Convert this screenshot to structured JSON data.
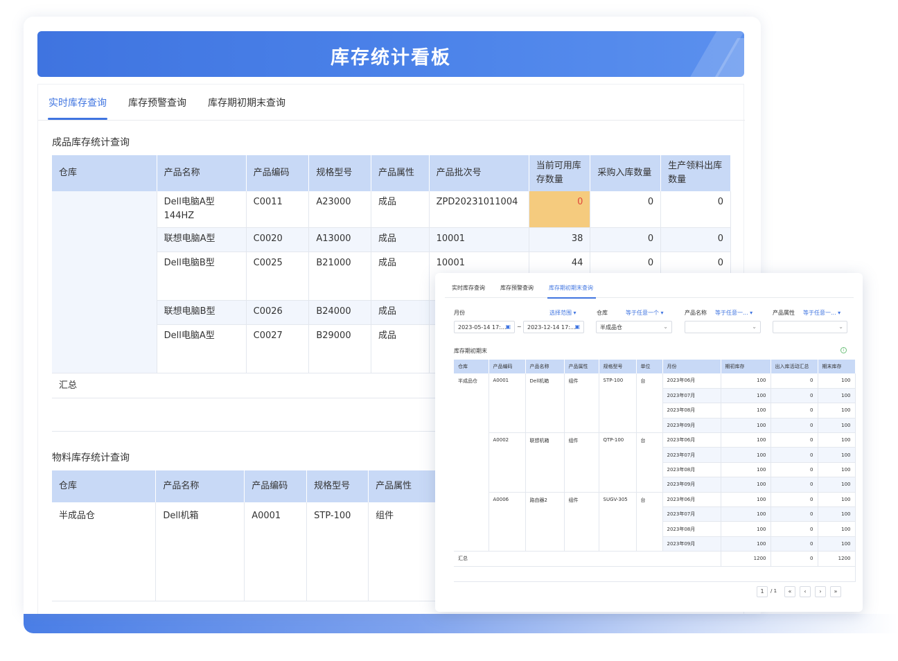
{
  "title": "库存统计看板",
  "tabs": [
    "实时库存查询",
    "库存预警查询",
    "库存期初期末查询"
  ],
  "colors": {
    "accent": "#3f74e0",
    "header_bg": "#c8d9f6",
    "warn_bg": "#f5cb7e",
    "warn_text": "#e0483a"
  },
  "finished": {
    "title": "成品库存统计查询",
    "headers": [
      "仓库",
      "产品名称",
      "产品编码",
      "规格型号",
      "产品属性",
      "产品批次号",
      "当前可用库\n存数量",
      "采购入库数量",
      "生产领料出库\n数量"
    ],
    "rows": [
      [
        "",
        "Dell电脑A型\n144HZ",
        "C0011",
        "A23000",
        "成品",
        "ZPD20231011004",
        "0",
        "0",
        "0"
      ],
      [
        "",
        "联想电脑A型",
        "C0020",
        "A13000",
        "成品",
        "10001",
        "38",
        "0",
        "0"
      ],
      [
        "",
        "Dell电脑B型",
        "C0025",
        "B21000",
        "成品",
        "10001",
        "44",
        "0",
        "0"
      ],
      [
        "",
        "联想电脑B型",
        "C0026",
        "B24000",
        "成品",
        "",
        "",
        "",
        ""
      ],
      [
        "",
        "Dell电脑A型",
        "C0027",
        "B29000",
        "成品",
        "",
        "",
        "",
        ""
      ]
    ],
    "total_label": "汇总"
  },
  "material": {
    "title": "物料库存统计查询",
    "headers": [
      "仓库",
      "产品名称",
      "产品编码",
      "规格型号",
      "产品属性"
    ],
    "rows": [
      [
        "半成品仓",
        "Dell机箱",
        "A0001",
        "STP-100",
        "组件"
      ]
    ]
  },
  "overlay": {
    "tabs": [
      "实时库存查询",
      "库存预警查询",
      "库存期初期末查询"
    ],
    "filters": {
      "month_label": "月份",
      "range_link": "选择范围",
      "date_from": "2023-05-14 17:...",
      "date_sep": "~",
      "date_to": "2023-12-14 17:...",
      "warehouse_label": "仓库",
      "warehouse_link": "等于任意一个",
      "warehouse_value": "半成品仓",
      "product_label": "产品名称",
      "product_link": "等于任意一...",
      "attr_label": "产品属性",
      "attr_link": "等于任意一..."
    },
    "section_title": "库存期初期末",
    "headers": [
      "仓库",
      "产品编码",
      "产品名称",
      "产品属性",
      "规格型号",
      "单位",
      "月份",
      "期初库存",
      "出入库活动汇总",
      "期末库存"
    ],
    "groups": [
      {
        "code": "A0001",
        "name": "Dell机箱",
        "attr": "组件",
        "spec": "STP-100",
        "unit": "台",
        "rows": [
          [
            "2023年06月",
            "100",
            "0",
            "100"
          ],
          [
            "2023年07月",
            "100",
            "0",
            "100"
          ],
          [
            "2023年08月",
            "100",
            "0",
            "100"
          ],
          [
            "2023年09月",
            "100",
            "0",
            "100"
          ]
        ]
      },
      {
        "code": "A0002",
        "name": "联想机箱",
        "attr": "组件",
        "spec": "QTP-100",
        "unit": "台",
        "rows": [
          [
            "2023年06月",
            "100",
            "0",
            "100"
          ],
          [
            "2023年07月",
            "100",
            "0",
            "100"
          ],
          [
            "2023年08月",
            "100",
            "0",
            "100"
          ],
          [
            "2023年09月",
            "100",
            "0",
            "100"
          ]
        ]
      },
      {
        "code": "A0006",
        "name": "路由器2",
        "attr": "组件",
        "spec": "SUGV-305",
        "unit": "台",
        "rows": [
          [
            "2023年06月",
            "100",
            "0",
            "100"
          ],
          [
            "2023年07月",
            "100",
            "0",
            "100"
          ],
          [
            "2023年08月",
            "100",
            "0",
            "100"
          ],
          [
            "2023年09月",
            "100",
            "0",
            "100"
          ]
        ]
      }
    ],
    "warehouse": "半成品仓",
    "total": {
      "label": "汇总",
      "begin": "1200",
      "activity": "0",
      "end": "1200"
    },
    "pager": {
      "page": "1",
      "of": "/ 1"
    }
  }
}
